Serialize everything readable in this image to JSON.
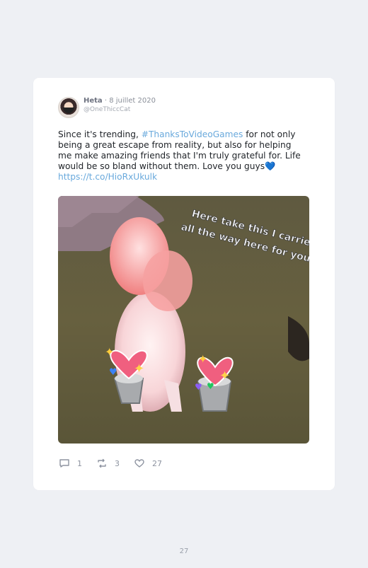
{
  "tweet": {
    "author_name": "Heta",
    "separator": " · ",
    "date": "8 juillet 2020",
    "handle": "@OneThiccCat",
    "text_part1": "Since it's trending, ",
    "hashtag": "#ThanksToVideoGames",
    "text_part2": " for not only being a great escape from reality, but also for helping me make amazing friends that I'm truly grateful for. Life would be so bland without them. Love you guys💙",
    "link": "https://t.co/HioRxUkulk",
    "media_caption_line1": "Here take this I carried it",
    "media_caption_line2": "all the way here for you",
    "replies": "1",
    "retweets": "3",
    "likes": "27"
  },
  "page_number": "27",
  "colors": {
    "accent": "#69a9dc",
    "background": "#eef0f4",
    "card": "#ffffff"
  },
  "icons": {
    "reply": "reply-icon",
    "retweet": "retweet-icon",
    "like": "heart-icon"
  }
}
